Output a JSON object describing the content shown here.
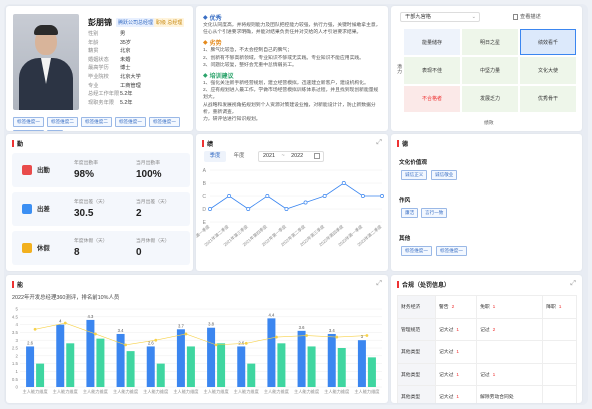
{
  "profile": {
    "name": "彭朋锦",
    "tag1": "腾跃公司总经理",
    "tag2": "职级 总经理",
    "fields": [
      {
        "k": "性别",
        "v": "男"
      },
      {
        "k": "年龄",
        "v": "35岁"
      },
      {
        "k": "籍贯",
        "v": "北京"
      },
      {
        "k": "婚姻状态",
        "v": "未婚"
      },
      {
        "k": "最高学历",
        "v": "博士"
      },
      {
        "k": "毕业院校",
        "v": "北京大学"
      },
      {
        "k": "专业",
        "v": "工商管理"
      },
      {
        "k": "总经工作年限",
        "v": "5.2年"
      },
      {
        "k": "现职务年限",
        "v": "5.2年"
      }
    ],
    "tags": [
      "标签维度一",
      "标签维度二",
      "标签维度二",
      "标签维度一",
      "标签维度一",
      "标签维度一",
      "+10"
    ]
  },
  "evaluation": {
    "sections": [
      {
        "title": "优秀",
        "color": "blue",
        "text": [
          "文化认同度高，并将规则能力及团队把控能力较强，执行力强，关键时候敢拿主意，",
          "任心从个引进要求明确，并能对结果负责任并对交给的人才引进要求结果。"
        ]
      },
      {
        "title": "劣势",
        "color": "orange",
        "text": [
          "1、脾气比较急，不太会控制自己的脾气；",
          "2、创新有不够高新领域，专业知识不够或无实践。专业知识不能应用实践。",
          "3、问题比较复，整好会无重中怠情弱员工。"
        ]
      },
      {
        "title": "培训建议",
        "color": "green",
        "text": [
          "1、强化关注新手新经营规划，建立经营模拟，迅速建立新客户，建设机构化。",
          "2、应有规划进入最工作，学做市场经营模拟训练体系过程，并且找到现创新能量规划大。",
          "从战略和发展视角拓规划到个人资源对策建设业推，对新能设计计，防止新数据分析，重新调查，",
          "力，研评估进行知识规划。"
        ]
      }
    ]
  },
  "ninebox": {
    "selector": "干部九宫格",
    "button": "查看描述",
    "ylabel": "潜力",
    "xlabel": "绩效",
    "cells": [
      "能量储存",
      "明日之星",
      "绩效看千",
      "表现不佳",
      "中坚力量",
      "文化大使",
      "不合格者",
      "发展乏力",
      "优秀骨干"
    ]
  },
  "attendance": {
    "title": "勤",
    "rows": [
      {
        "label": "出勤",
        "k1": "年度出勤率",
        "v1": "98%",
        "k2": "当月出勤率",
        "v2": "100%",
        "color": "#e94b4b"
      },
      {
        "label": "出差",
        "k1": "年度出差（天）",
        "v1": "30.5",
        "k2": "当月出差（天）",
        "v2": "2",
        "color": "#3b8ff3"
      },
      {
        "label": "休假",
        "k1": "年度休假（天）",
        "v1": "8",
        "k2": "当月休假（天）",
        "v2": "0",
        "color": "#f2b01e"
      }
    ]
  },
  "performance": {
    "title": "绩",
    "tabs": [
      "季度",
      "年度"
    ],
    "date_from": "2021",
    "date_sep": "~",
    "date_to": "2022"
  },
  "line_chart": {
    "type": "line",
    "ylim": [
      0,
      8
    ],
    "yticks": [
      "E",
      "D",
      "C",
      "B",
      "A"
    ],
    "categories": [
      "2021年第一季度",
      "2021年第二季度",
      "2021年第三季度",
      "2021年第四季度",
      "2022年第一季度",
      "2022年第二季度",
      "2022年第三季度",
      "2022年第四季度",
      "2023年第一季度",
      "2023年第二季度"
    ],
    "values": [
      2,
      4,
      2,
      4,
      2,
      3,
      4,
      6,
      4,
      4
    ]
  },
  "traits": {
    "title": "德",
    "groups": [
      {
        "title": "文化价值观",
        "chips": [
          "诚信正义",
          "诚信敬业"
        ]
      },
      {
        "title": "作风",
        "chips": [
          "廉洁",
          "言行一致"
        ]
      },
      {
        "title": "其他",
        "chips": [
          "标签维度一",
          "标签维度一"
        ]
      }
    ]
  },
  "ability": {
    "title": "能",
    "subtitle": "2022年开发总经理360测评，排名前10%人员"
  },
  "chart_data": {
    "type": "bar",
    "categories": [
      "主人能力维度",
      "主人能力维度",
      "主人能力维度",
      "主人能力维度",
      "主人能力维度",
      "主人能力维度",
      "主人能力维度",
      "主人能力维度",
      "主人能力维度",
      "主人能力维度",
      "主人能力维度",
      "主人能力维度"
    ],
    "ylim": [
      0,
      5
    ],
    "yticks": [
      0,
      0.5,
      1,
      1.5,
      2,
      2.5,
      3,
      3.5,
      4,
      4.5,
      5
    ],
    "series": [
      {
        "values": [
          2.6,
          4.0,
          4.3,
          3.4,
          2.6,
          3.7,
          3.8,
          2.6,
          4.4,
          3.6,
          3.4,
          3.0
        ],
        "color": "#3b86f0"
      },
      {
        "values": [
          1.5,
          2.8,
          3.1,
          2.3,
          1.5,
          2.6,
          2.8,
          1.5,
          2.8,
          2.6,
          2.5,
          1.9
        ],
        "color": "#3fd6a0"
      },
      {
        "values": [
          3.7,
          4.1,
          3.4,
          2.7,
          3.0,
          3.4,
          2.7,
          2.8,
          3.2,
          3.3,
          3.2,
          3.3
        ],
        "color": "#f7d24b"
      }
    ],
    "labels": [
      2.6,
      4.0,
      4.3,
      3.4,
      2.6,
      3.7,
      3.8,
      2.6,
      4.4,
      3.6,
      3.4,
      3.0
    ]
  },
  "compliance": {
    "title": "合规（处罚信息）",
    "rows": [
      {
        "k": "财务经济",
        "c1": "警告",
        "n1": "2",
        "c2": "免职",
        "n2": "1",
        "c3": "降职",
        "n3": "1"
      },
      {
        "k": "管理规范",
        "c1": "记大过",
        "n1": "1",
        "c2": "记过",
        "n2": "2",
        "c3": "",
        "n3": ""
      },
      {
        "k": "其他类型",
        "c1": "记大过",
        "n1": "1",
        "c2": "",
        "n2": "",
        "c3": "",
        "n3": ""
      },
      {
        "k": "其他类型",
        "c1": "记大过",
        "n1": "1",
        "c2": "记过",
        "n2": "1",
        "c3": "",
        "n3": ""
      },
      {
        "k": "其他类型",
        "c1": "记大过",
        "n1": "1",
        "c2": "解除劳动合同处",
        "n2": "",
        "c3": "",
        "n3": ""
      }
    ]
  }
}
